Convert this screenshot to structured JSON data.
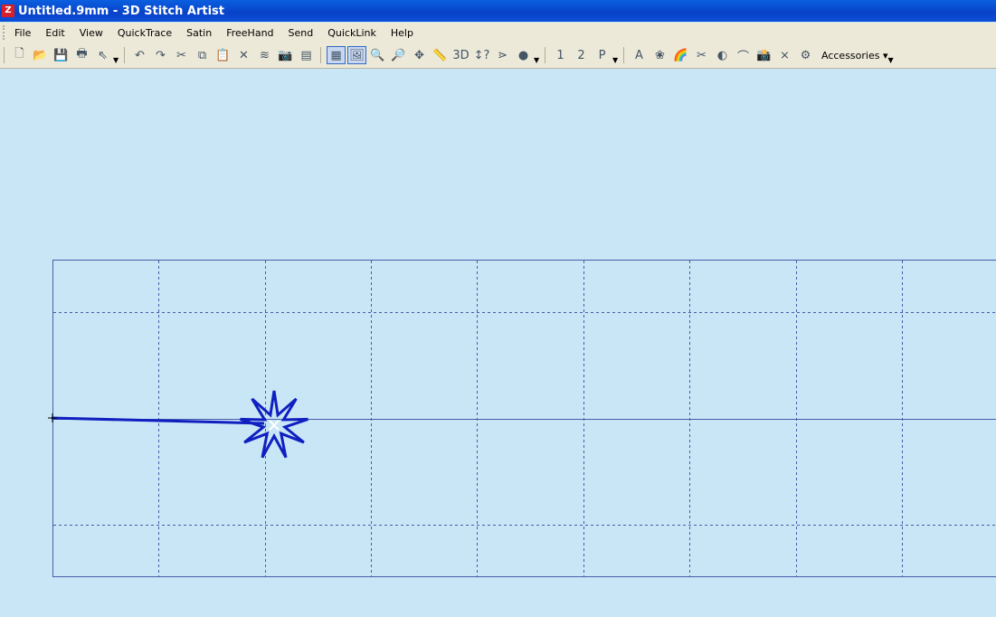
{
  "window": {
    "title": "Untitled.9mm - 3D Stitch Artist"
  },
  "menu": [
    "File",
    "Edit",
    "View",
    "QuickTrace",
    "Satin",
    "FreeHand",
    "Send",
    "QuickLink",
    "Help"
  ],
  "toolbar": {
    "group1": [
      {
        "name": "new-icon",
        "g": "🗋"
      },
      {
        "name": "open-icon",
        "g": "📂"
      },
      {
        "name": "save-icon",
        "g": "💾"
      },
      {
        "name": "print-icon",
        "g": "🖶"
      },
      {
        "name": "help-pointer-icon",
        "g": "⇖"
      }
    ],
    "group2": [
      {
        "name": "undo-icon",
        "g": "↶"
      },
      {
        "name": "redo-icon",
        "g": "↷"
      },
      {
        "name": "cut-icon",
        "g": "✂"
      },
      {
        "name": "copy-icon",
        "g": "⧉"
      },
      {
        "name": "paste-icon",
        "g": "📋"
      },
      {
        "name": "delete-icon",
        "g": "✕"
      },
      {
        "name": "stitch-list-icon",
        "g": "≋"
      },
      {
        "name": "camera-icon",
        "g": "📷"
      },
      {
        "name": "properties-icon",
        "g": "▤"
      }
    ],
    "group3": [
      {
        "name": "grid-icon",
        "g": "▦"
      },
      {
        "name": "picture-icon",
        "g": "🖼"
      },
      {
        "name": "zoom-in-icon",
        "g": "🔍"
      },
      {
        "name": "zoom-out-icon",
        "g": "🔎"
      },
      {
        "name": "zoom-fit-icon",
        "g": "✥"
      },
      {
        "name": "ruler-icon",
        "g": "📏"
      },
      {
        "name": "3d-view-icon",
        "g": "3D"
      },
      {
        "name": "stitch-info-icon",
        "g": "↕?"
      },
      {
        "name": "path-icon",
        "g": "⋗"
      },
      {
        "name": "colors-icon",
        "g": "●"
      }
    ],
    "group4": [
      {
        "name": "needle-1-icon",
        "g": "1"
      },
      {
        "name": "needle-2-icon",
        "g": "2"
      },
      {
        "name": "needle-p-icon",
        "g": "P"
      }
    ],
    "group5": [
      {
        "name": "3d-text-icon",
        "g": "A"
      },
      {
        "name": "monogram-icon",
        "g": "❀"
      },
      {
        "name": "rainbow-icon",
        "g": "🌈"
      },
      {
        "name": "scissors-icon",
        "g": "✂"
      },
      {
        "name": "globe-icon",
        "g": "◐"
      },
      {
        "name": "curve-icon",
        "g": "⌒"
      },
      {
        "name": "camera2-icon",
        "g": "📸"
      },
      {
        "name": "cross-stitch-icon",
        "g": "⨯"
      },
      {
        "name": "tools-icon",
        "g": "⚙"
      }
    ],
    "accessories": "Accessories ▾"
  },
  "colors": {
    "grid": "#4a5ca8",
    "stitch": "#1020c0",
    "canvas": "#c8e6f6"
  }
}
